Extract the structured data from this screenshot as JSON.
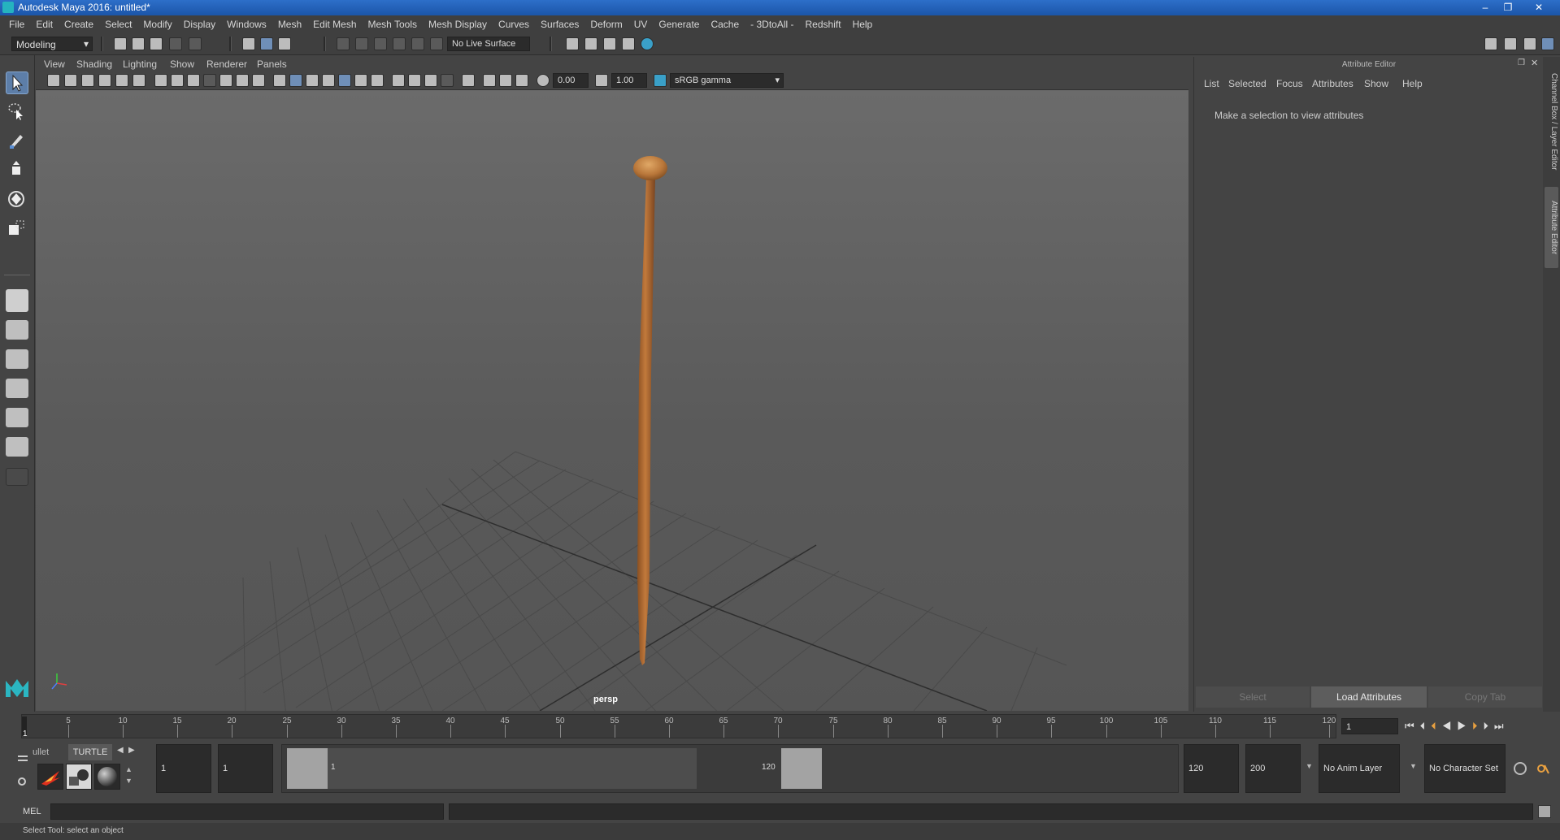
{
  "window": {
    "title": "Autodesk Maya 2016: untitled*",
    "controls": [
      "–",
      "❐",
      "✕"
    ]
  },
  "menubar": {
    "items": [
      "File",
      "Edit",
      "Create",
      "Select",
      "Modify",
      "Display",
      "Windows",
      "Mesh",
      "Edit Mesh",
      "Mesh Tools",
      "Mesh Display",
      "Curves",
      "Surfaces",
      "Deform",
      "UV",
      "Generate",
      "Cache",
      "- 3DtoAll -",
      "Redshift",
      "Help"
    ]
  },
  "statusline": {
    "menuset": "Modeling",
    "live_surface": "No Live Surface"
  },
  "panel": {
    "menus": [
      "View",
      "Shading",
      "Lighting",
      "Show",
      "Renderer",
      "Panels"
    ],
    "exposure": "0.00",
    "gamma": "1.00",
    "colorspace": "sRGB gamma",
    "camera_label": "persp"
  },
  "attribute_editor": {
    "title": "Attribute Editor",
    "menus": [
      "List",
      "Selected",
      "Focus",
      "Attributes",
      "Show",
      "Help"
    ],
    "message": "Make a selection to view attributes",
    "buttons": {
      "select": "Select",
      "load": "Load Attributes",
      "copy_tab": "Copy Tab"
    }
  },
  "side_tabs": {
    "channel_box": "Channel Box / Layer Editor",
    "attribute_editor": "Attribute Editor"
  },
  "time_slider": {
    "ticks": [
      "5",
      "10",
      "15",
      "20",
      "25",
      "30",
      "35",
      "40",
      "45",
      "50",
      "55",
      "60",
      "65",
      "70",
      "75",
      "80",
      "85",
      "90",
      "95",
      "100",
      "105",
      "110",
      "115",
      "120"
    ],
    "current_frame_label": "1",
    "current_time": "1"
  },
  "range_slider": {
    "shelf_tabs": [
      "ullet",
      "TURTLE"
    ],
    "start_time": "1",
    "playback_start": "1",
    "range_start_label": "1",
    "range_end_label": "120",
    "playback_end": "120",
    "end_time": "200",
    "anim_layer": "No Anim Layer",
    "character_set": "No Character Set"
  },
  "command_line": {
    "language": "MEL"
  },
  "help_line": {
    "text": "Select Tool: select an object"
  },
  "colors": {
    "accent": "#5d7ea8",
    "stick": "#b87333",
    "titlebar": "#1b55a8"
  }
}
